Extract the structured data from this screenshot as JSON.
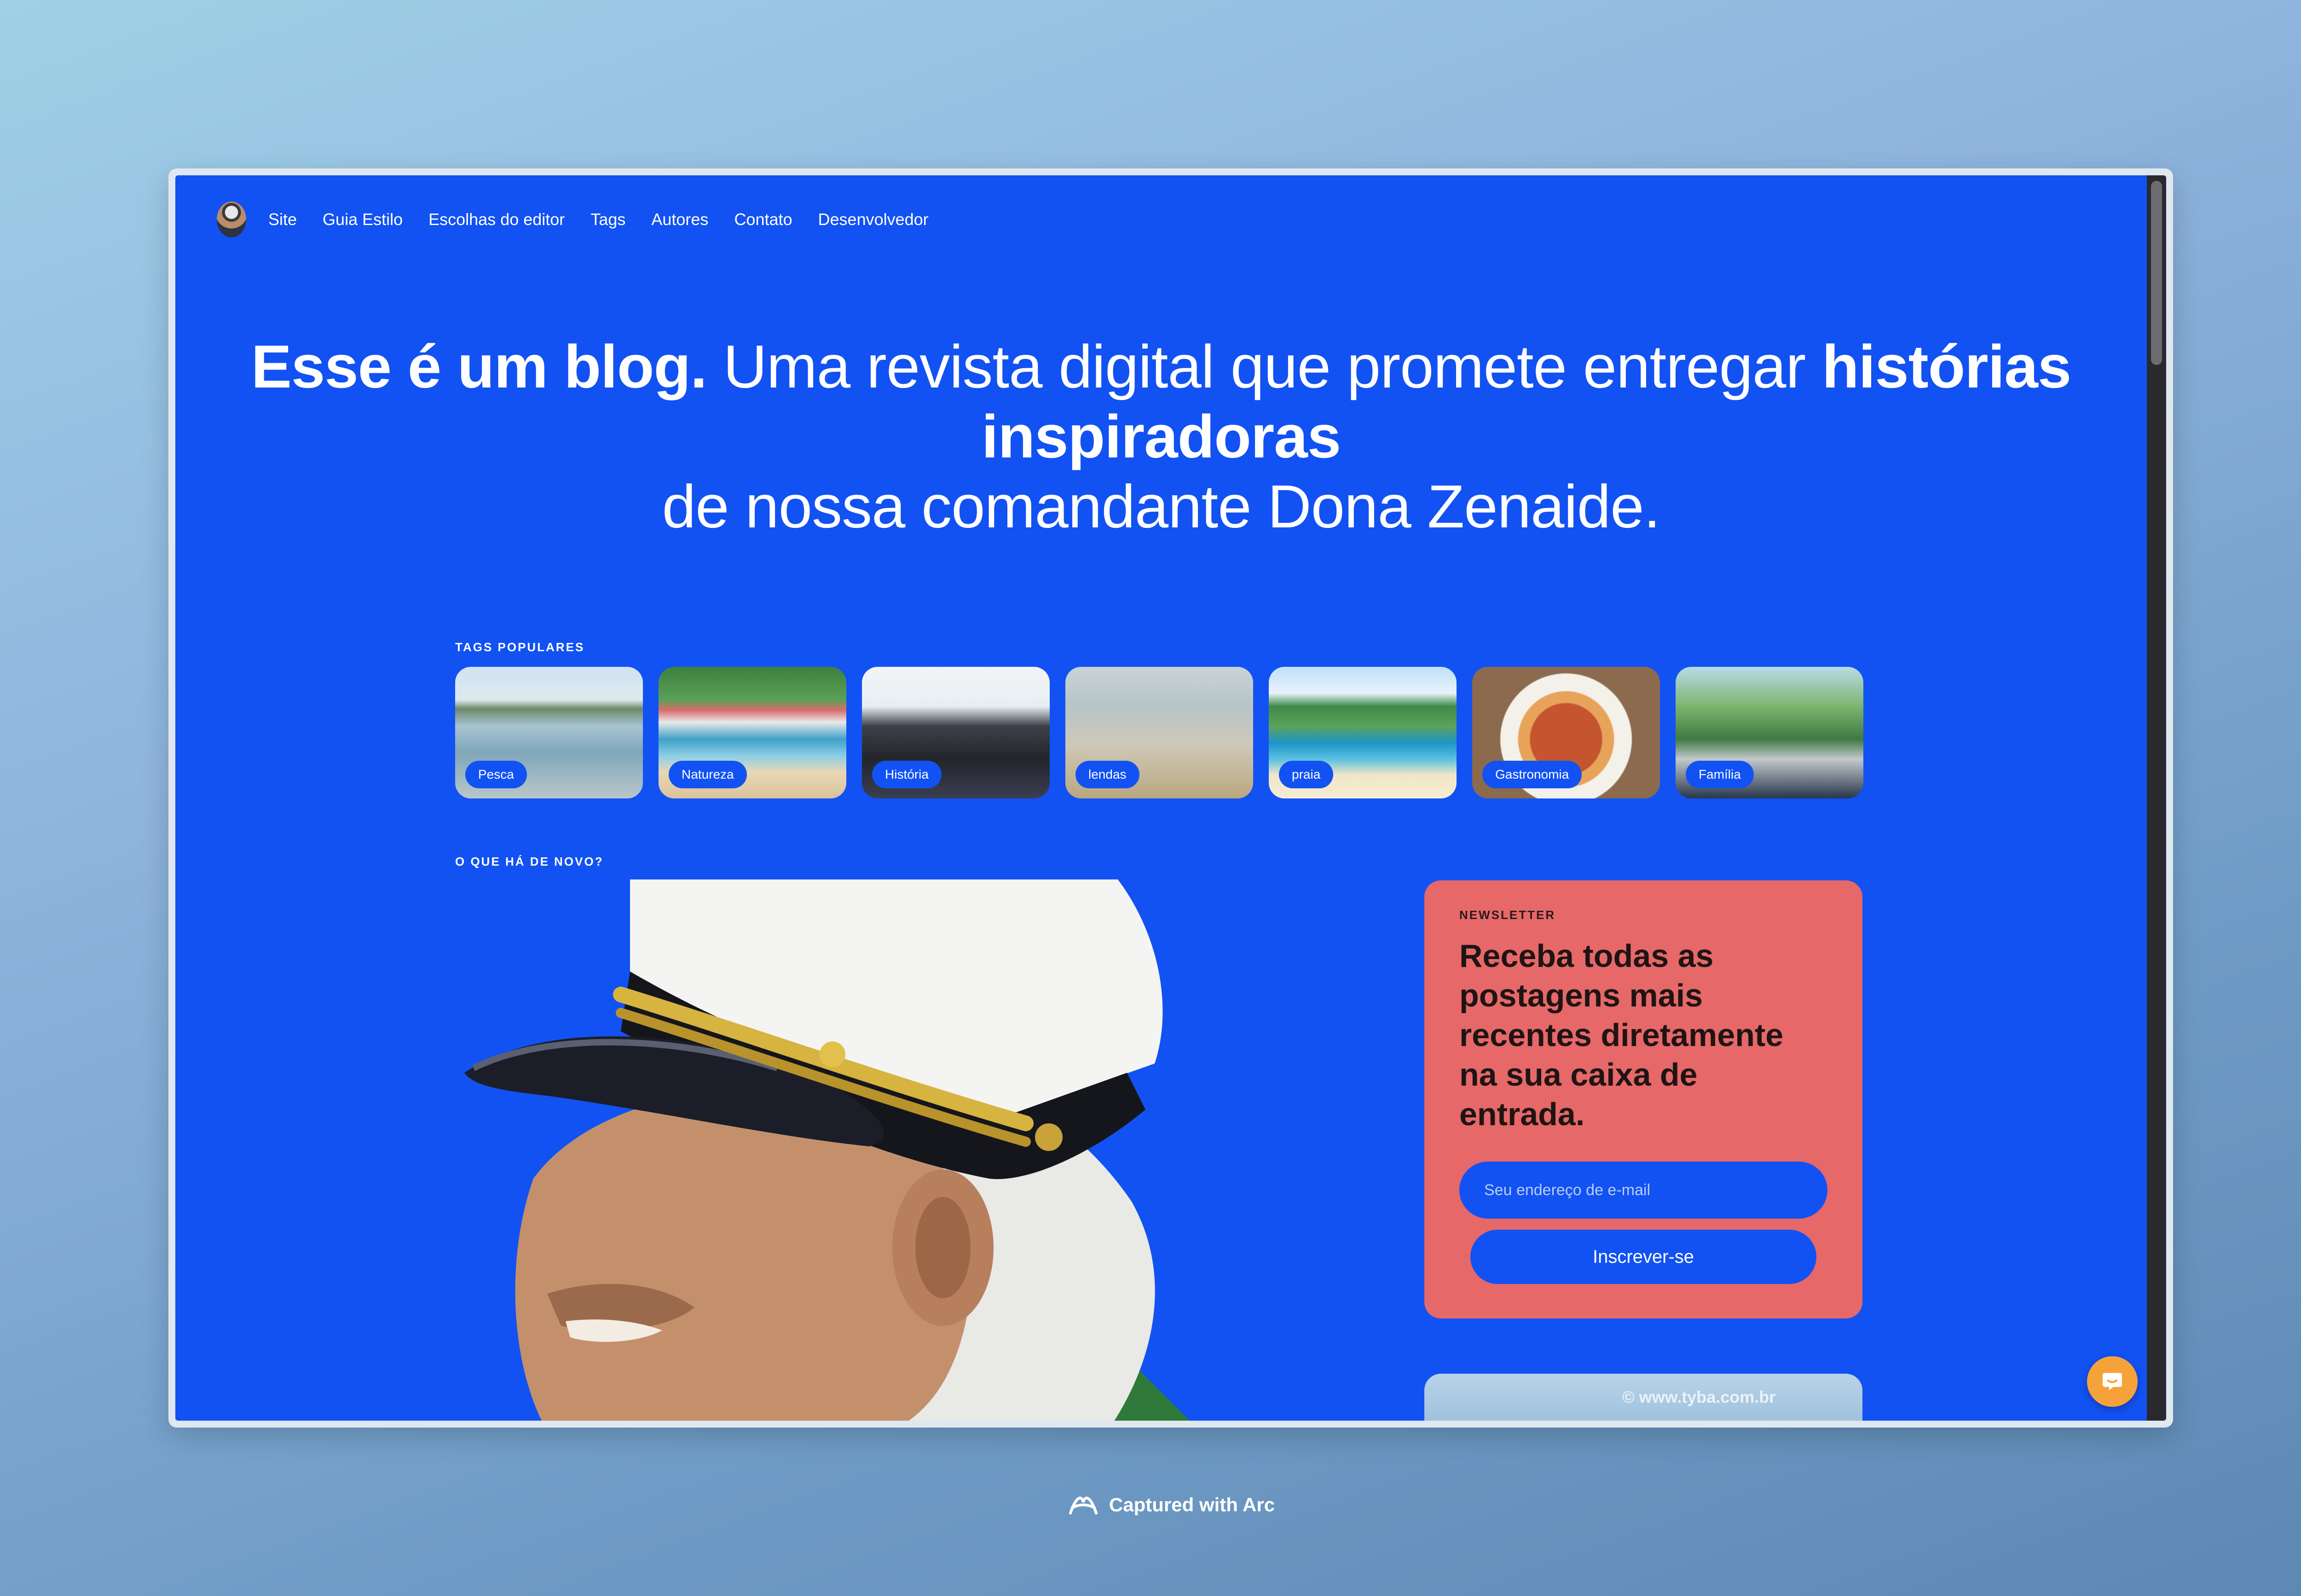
{
  "nav": {
    "items": [
      "Site",
      "Guia Estilo",
      "Escolhas do editor",
      "Tags",
      "Autores",
      "Contato",
      "Desenvolvedor"
    ]
  },
  "hero": {
    "part1_bold": "Esse é um blog.",
    "part2": " Uma revista digital que promete entregar ",
    "part3_bold": "histórias inspiradoras",
    "part4": " de nossa comandante Dona Zenaide."
  },
  "tags_section": {
    "label": "TAGS POPULARES",
    "tags": [
      {
        "label": "Pesca"
      },
      {
        "label": "Natureza"
      },
      {
        "label": "História"
      },
      {
        "label": "lendas"
      },
      {
        "label": "praia"
      },
      {
        "label": "Gastronomia"
      },
      {
        "label": "Família"
      }
    ]
  },
  "news_section": {
    "label": "O QUE HÁ DE NOVO?"
  },
  "newsletter": {
    "label": "NEWSLETTER",
    "headline": "Receba todas as postagens mais recentes diretamente na sua caixa de entrada.",
    "email_placeholder": "Seu endereço de e-mail",
    "button_label": "Inscrever-se"
  },
  "next_card": {
    "watermark": "© www.tyba.com.br"
  },
  "footer": {
    "capture_label": "Captured with Arc"
  },
  "colors": {
    "page_blue": "#1252f3",
    "newsletter_red": "#e66868",
    "chat_orange": "#f6a23a"
  }
}
